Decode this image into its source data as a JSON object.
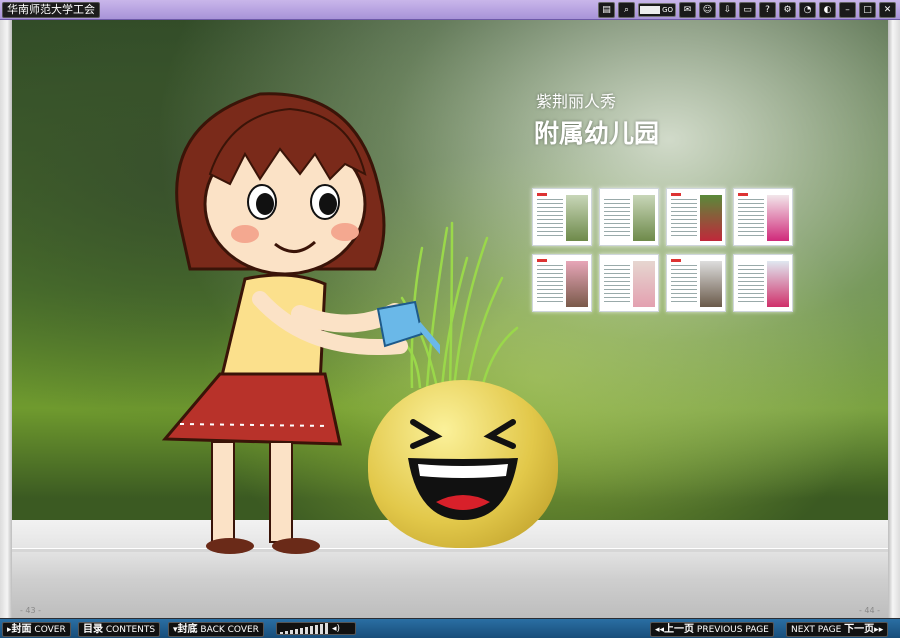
{
  "window": {
    "title": "华南师范大学工会"
  },
  "toolbar": {
    "page_input_go": "GO",
    "icons": [
      "print-icon",
      "search-icon",
      "page-input",
      "comment-icon",
      "user-icon",
      "download-icon",
      "printer-icon",
      "help-icon",
      "settings-icon",
      "clock-icon",
      "theme-icon",
      "minimize-icon",
      "maximize-icon",
      "close-icon"
    ]
  },
  "page": {
    "subtitle": "紫荆丽人秀",
    "heading": "附属幼儿园",
    "left_page_number": "- 43 -",
    "right_page_number": "- 44 -",
    "thumbnails_count": 8
  },
  "bottombar": {
    "cover": {
      "cn": "封面",
      "en": "COVER"
    },
    "contents": {
      "cn": "目录",
      "en": "CONTENTS"
    },
    "back_cover": {
      "cn": "封底",
      "en": "BACK COVER"
    },
    "previous": {
      "cn": "上一页",
      "en": "PREVIOUS PAGE"
    },
    "next": {
      "cn": "下一页",
      "en": "NEXT PAGE"
    }
  },
  "colors": {
    "topbar": "#b7a3e0",
    "bottombar": "#1f5e92",
    "heading": "#ffffff"
  }
}
